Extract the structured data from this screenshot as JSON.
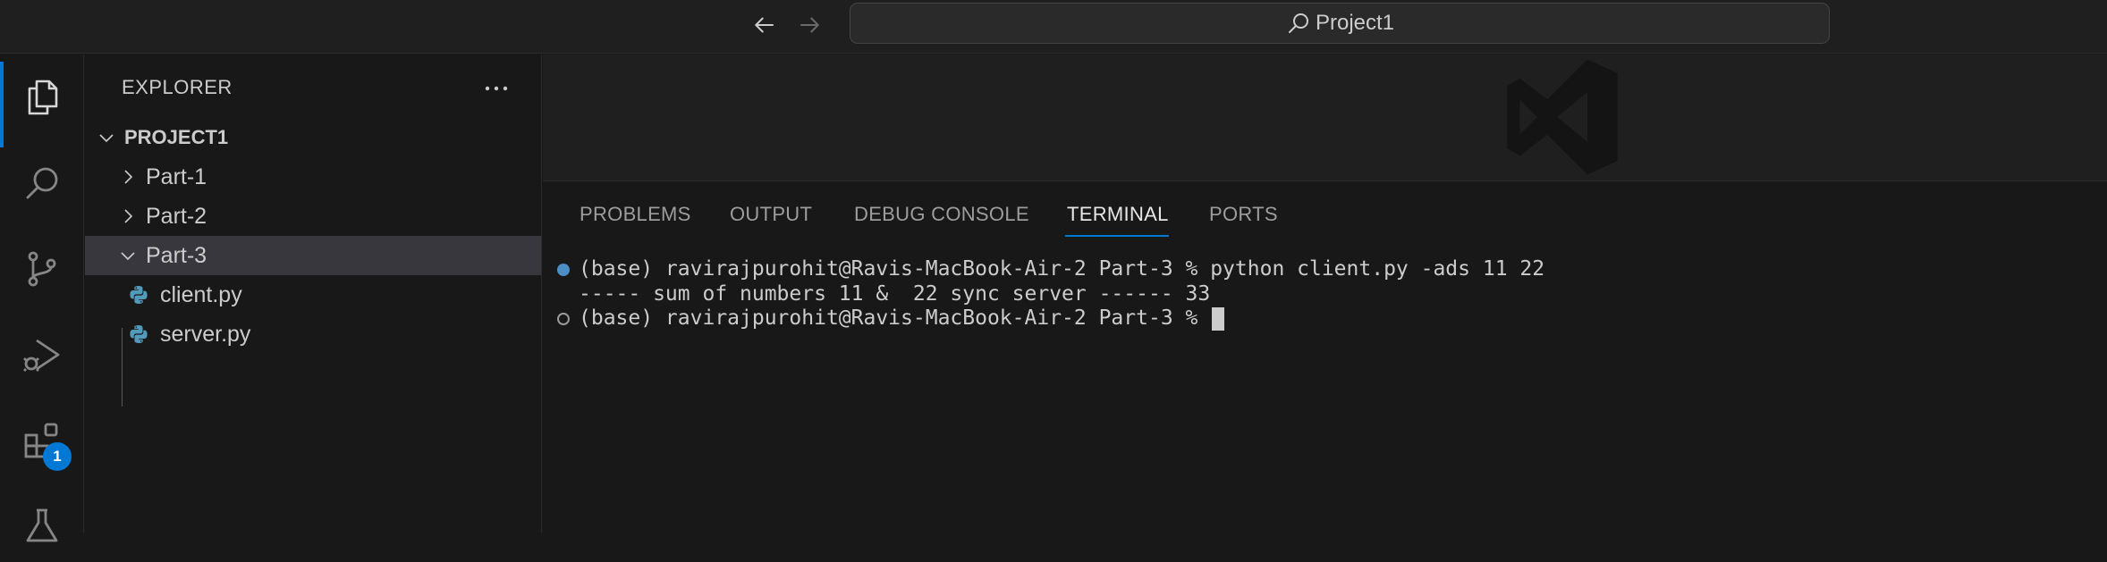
{
  "titlebar": {
    "search_text": "Project1",
    "icons": [
      "arrow-left-icon",
      "arrow-right-icon",
      "search-icon"
    ]
  },
  "activitybar": {
    "items": [
      {
        "name": "explorer",
        "icon": "files-icon",
        "active": true
      },
      {
        "name": "search",
        "icon": "search-icon"
      },
      {
        "name": "source-control",
        "icon": "source-control-icon"
      },
      {
        "name": "run-debug",
        "icon": "run-debug-icon"
      },
      {
        "name": "extensions",
        "icon": "extensions-icon",
        "badge": "1"
      },
      {
        "name": "testing",
        "icon": "beaker-icon"
      }
    ],
    "extensions_badge": "1"
  },
  "sidebar": {
    "title": "EXPLORER",
    "root": "PROJECT1",
    "items": [
      {
        "label": "Part-1",
        "type": "folder",
        "expanded": false
      },
      {
        "label": "Part-2",
        "type": "folder",
        "expanded": false
      },
      {
        "label": "Part-3",
        "type": "folder",
        "expanded": true,
        "selected": true
      },
      {
        "label": "client.py",
        "type": "python-file"
      },
      {
        "label": "server.py",
        "type": "python-file"
      }
    ]
  },
  "panel": {
    "tabs": [
      {
        "label": "PROBLEMS"
      },
      {
        "label": "OUTPUT"
      },
      {
        "label": "DEBUG CONSOLE"
      },
      {
        "label": "TERMINAL",
        "active": true
      },
      {
        "label": "PORTS"
      }
    ],
    "terminal": {
      "lines": [
        "(base) ravirajpurohit@Ravis-MacBook-Air-2 Part-3 % python client.py -ads 11 22",
        "----- sum of numbers 11 &  22 sync server ------ 33",
        "(base) ravirajpurohit@Ravis-MacBook-Air-2 Part-3 % "
      ]
    }
  },
  "colors": {
    "accent": "#0078d4",
    "background": "#181818",
    "editor_background": "#1f1f1f",
    "selection": "#37373d",
    "python_icon": "#519aba"
  }
}
